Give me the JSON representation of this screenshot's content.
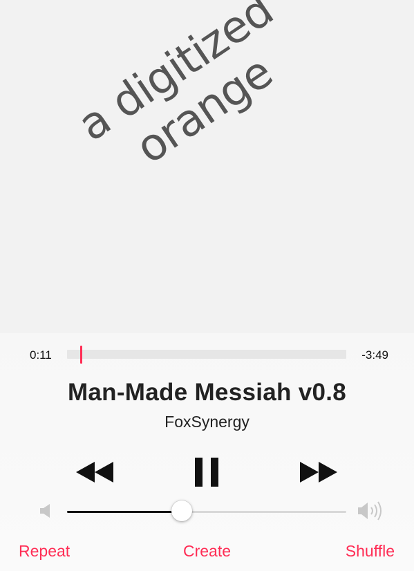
{
  "artwork": {
    "line1": "a digitized",
    "line2": "orange"
  },
  "playback": {
    "elapsed": "0:11",
    "remaining": "-3:49",
    "progress_fraction": 0.05
  },
  "track": {
    "title": "Man-Made Messiah v0.8",
    "artist": "FoxSynergy"
  },
  "controls": {
    "rewind_icon": "rewind-icon",
    "pause_icon": "pause-icon",
    "forward_icon": "fast-forward-icon"
  },
  "volume": {
    "level_fraction": 0.41,
    "low_icon": "speaker-low-icon",
    "high_icon": "speaker-high-icon"
  },
  "bottom_actions": {
    "repeat": "Repeat",
    "create": "Create",
    "shuffle": "Shuffle"
  },
  "colors": {
    "accent": "#ff2d55",
    "art_text": "#555555",
    "background": "#f2f2f2"
  }
}
